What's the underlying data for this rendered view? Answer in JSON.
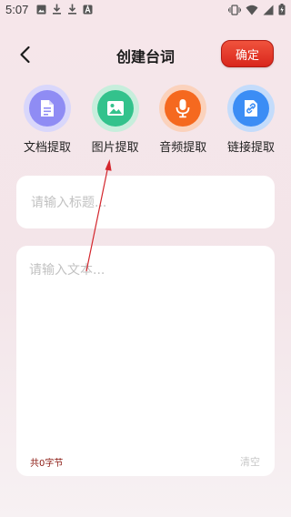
{
  "status_bar": {
    "time": "5:07"
  },
  "header": {
    "title": "创建台词",
    "confirm_label": "确定"
  },
  "tools": [
    {
      "label": "文档提取",
      "icon": "document-icon",
      "color": "#8f8cf4"
    },
    {
      "label": "图片提取",
      "icon": "image-icon",
      "color": "#33c28c"
    },
    {
      "label": "音频提取",
      "icon": "microphone-icon",
      "color": "#f5691f"
    },
    {
      "label": "链接提取",
      "icon": "link-icon",
      "color": "#3b8df5"
    }
  ],
  "title_input": {
    "placeholder": "请输入标题..."
  },
  "text_input": {
    "placeholder": "请输入文本..."
  },
  "footer": {
    "byte_count": "共0字节",
    "clear_label": "清空"
  },
  "colors": {
    "accent": "#e0301e",
    "annotation": "#d4262d"
  }
}
